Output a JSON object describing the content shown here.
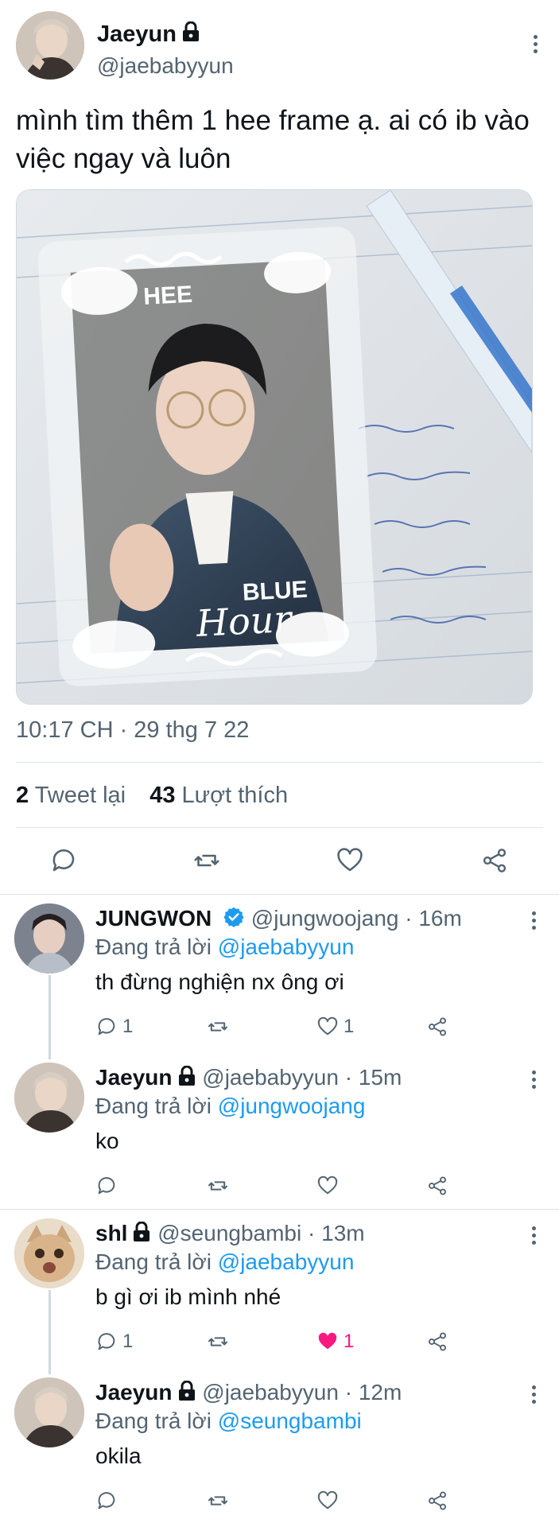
{
  "main": {
    "name": "Jaeyun",
    "handle": "@jaebabyyun",
    "text": "mình tìm thêm 1 hee frame ạ. ai có ib vào việc ngay và luôn",
    "timestamp": "10:17 CH · 29 thg 7 22",
    "retweets": {
      "count": "2",
      "label": "Tweet lại"
    },
    "likes": {
      "count": "43",
      "label": "Lượt thích"
    },
    "photo_text": {
      "top": "HEE",
      "bottom1": "BLUE",
      "bottom2": "Hour"
    }
  },
  "replies": [
    {
      "name": "JUNGWON",
      "verified": true,
      "protected": false,
      "handle": "@jungwoojang",
      "time": "· 16m",
      "replying_label": "Đang trả lời",
      "replying_to": "@jaebabyyun",
      "text": "th đừng nghiện nx ông ơi",
      "reply_count": "1",
      "retweet_count": "",
      "like_count": "1",
      "liked": false
    },
    {
      "name": "Jaeyun",
      "verified": false,
      "protected": true,
      "handle": "@jaebabyyun",
      "time": "· 15m",
      "replying_label": "Đang trả lời",
      "replying_to": "@jungwoojang",
      "text": "ko",
      "reply_count": "",
      "retweet_count": "",
      "like_count": "",
      "liked": false
    },
    {
      "name": "shl",
      "verified": false,
      "protected": true,
      "handle": "@seungbambi",
      "time": "· 13m",
      "replying_label": "Đang trả lời",
      "replying_to": "@jaebabyyun",
      "text": "b gì ơi ib mình nhé",
      "reply_count": "1",
      "retweet_count": "",
      "like_count": "1",
      "liked": true
    },
    {
      "name": "Jaeyun",
      "verified": false,
      "protected": true,
      "handle": "@jaebabyyun",
      "time": "· 12m",
      "replying_label": "Đang trả lời",
      "replying_to": "@seungbambi",
      "text": "okila",
      "reply_count": "",
      "retweet_count": "",
      "like_count": "",
      "liked": false
    }
  ],
  "icons": {
    "reply": "reply-icon",
    "retweet": "retweet-icon",
    "like": "heart-icon",
    "share": "share-icon",
    "lock": "lock-icon",
    "verified": "verified-badge-icon",
    "more": "more-icon"
  },
  "colors": {
    "accent": "#1d9bf0",
    "secondary_text": "#536471",
    "like": "#f91880",
    "divider": "#dde3e7"
  }
}
